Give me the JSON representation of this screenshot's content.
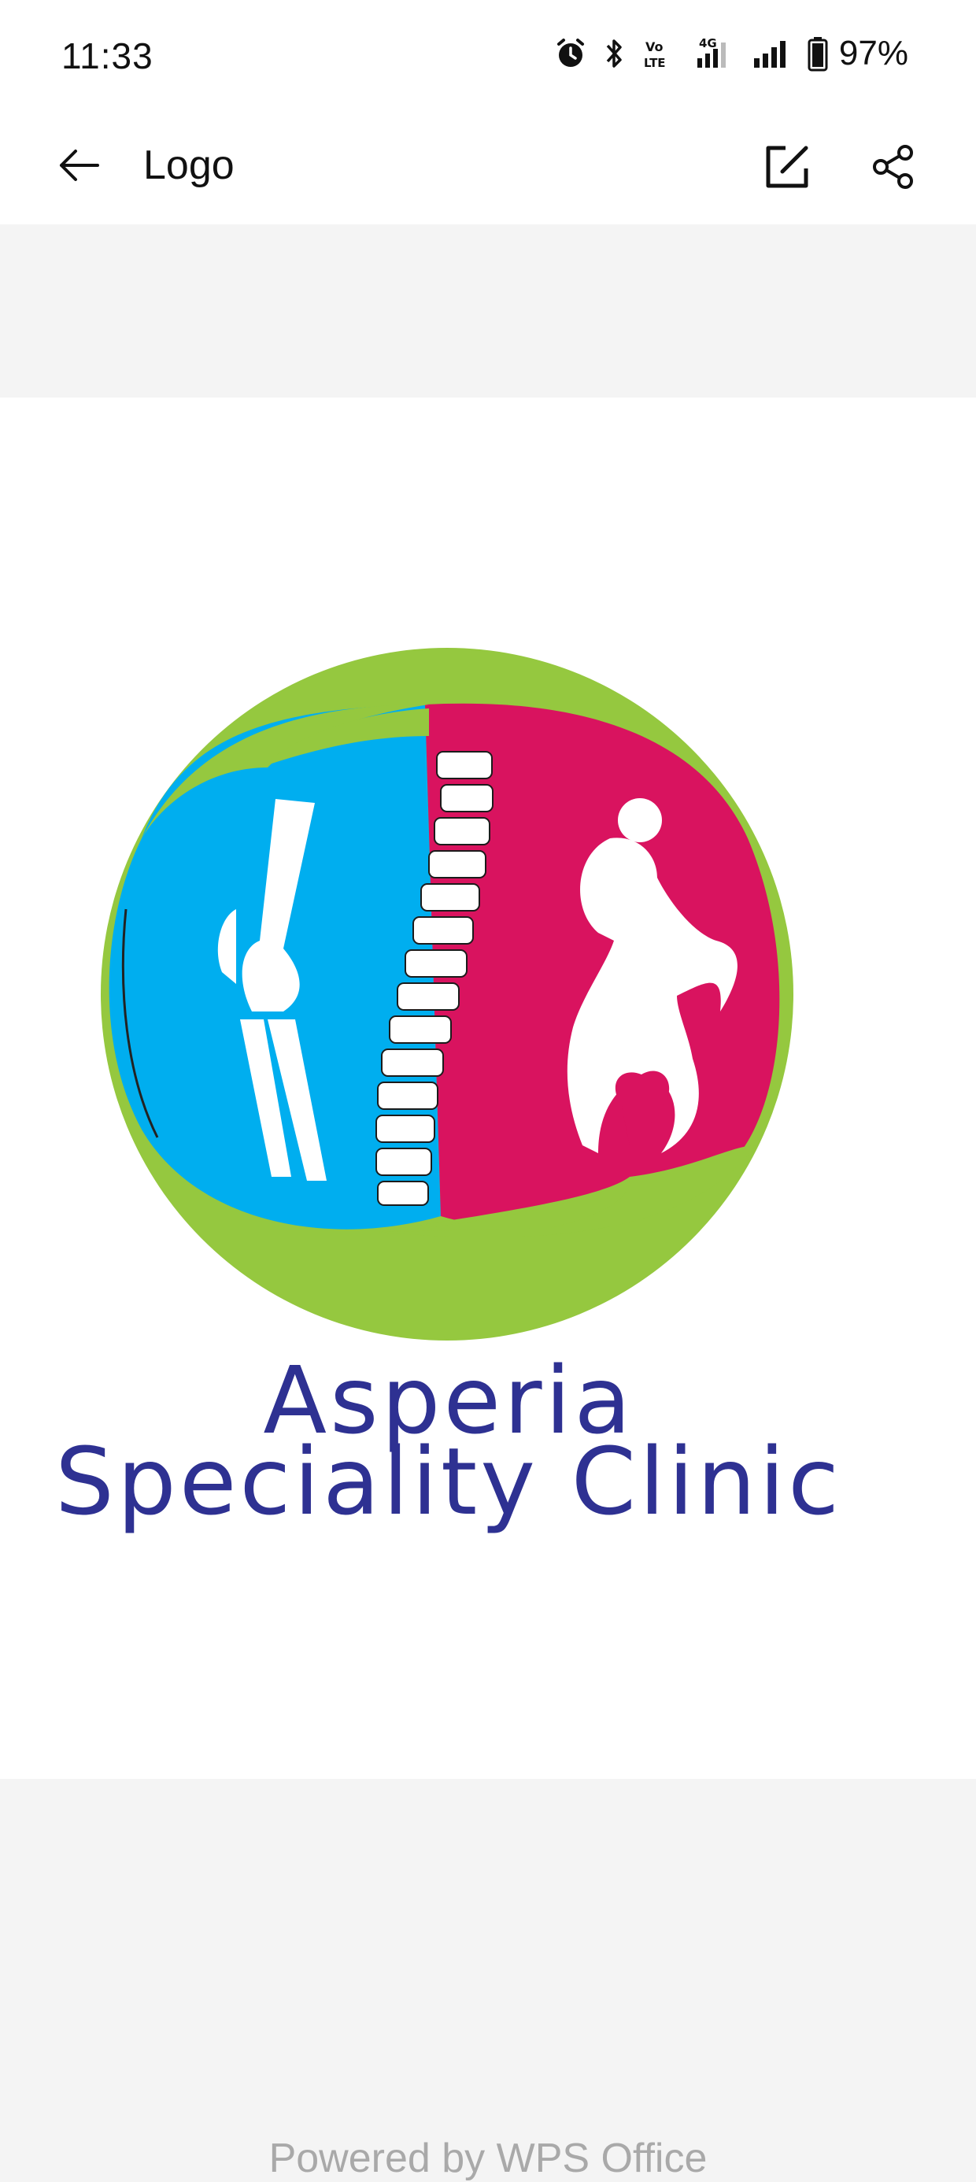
{
  "status_bar": {
    "time": "11:33",
    "battery_percent": "97%",
    "icons": [
      "alarm-icon",
      "bluetooth-icon",
      "volte-icon",
      "signal-4g-icon",
      "signal-icon",
      "battery-icon"
    ],
    "volte_label": "Vo LTE",
    "network_label": "4G"
  },
  "app_bar": {
    "title": "Logo",
    "back_icon": "arrow-left-icon",
    "actions": [
      "edit-icon",
      "share-icon"
    ]
  },
  "document": {
    "logo": {
      "line1": "Asperia",
      "line2": "Speciality Clinic",
      "colors": {
        "green": "#95c83f",
        "blue": "#00aeef",
        "magenta": "#d9135f",
        "text": "#2e3192"
      }
    }
  },
  "footer": {
    "text": "Powered by WPS Office"
  }
}
